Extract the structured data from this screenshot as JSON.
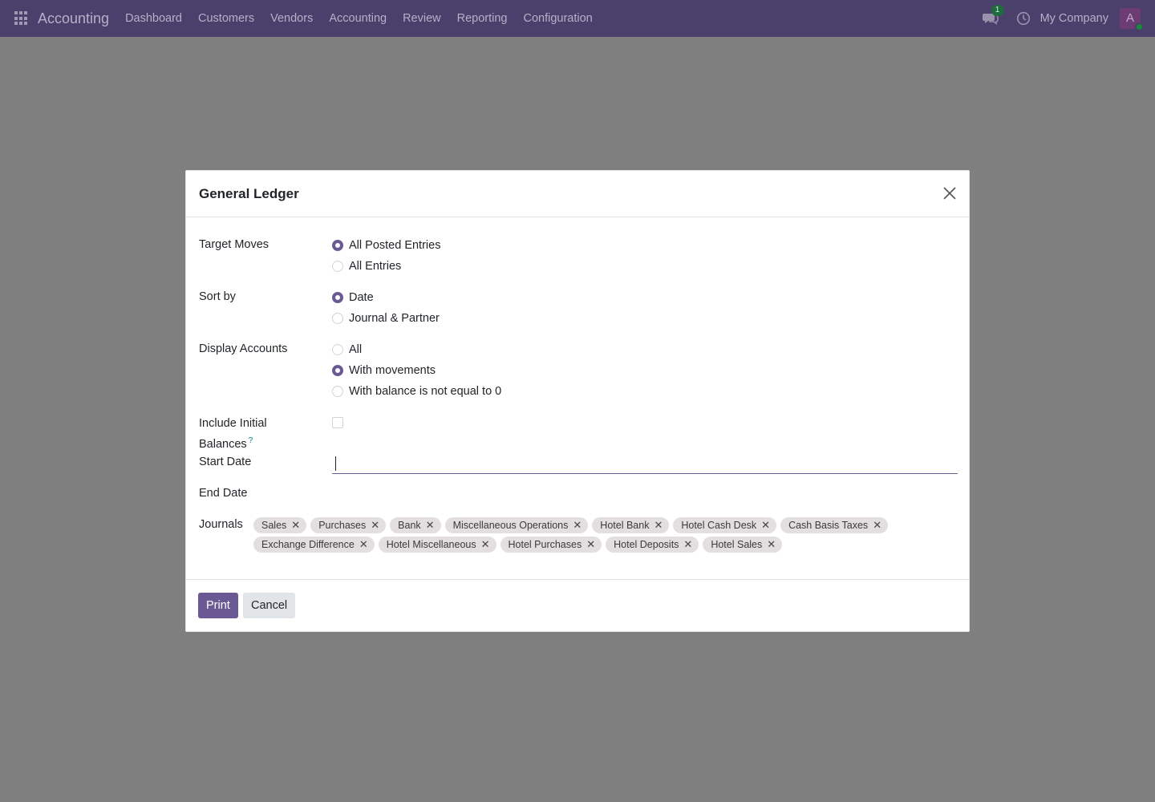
{
  "navbar": {
    "brand": "Accounting",
    "menu": [
      "Dashboard",
      "Customers",
      "Vendors",
      "Accounting",
      "Review",
      "Reporting",
      "Configuration"
    ],
    "chat_count": "1",
    "company": "My Company",
    "avatar_initial": "A"
  },
  "dialog": {
    "title": "General Ledger",
    "target_moves": {
      "label": "Target Moves",
      "options": [
        "All Posted Entries",
        "All Entries"
      ],
      "selected": 0
    },
    "sort_by": {
      "label": "Sort by",
      "options": [
        "Date",
        "Journal & Partner"
      ],
      "selected": 0
    },
    "display_accounts": {
      "label": "Display Accounts",
      "options": [
        "All",
        "With movements",
        "With balance is not equal to 0"
      ],
      "selected": 1
    },
    "initial_balances": {
      "label_line1": "Include Initial",
      "label_line2": "Balances",
      "help": "?",
      "checked": false
    },
    "start_date": {
      "label": "Start Date",
      "value": ""
    },
    "end_date": {
      "label": "End Date"
    },
    "journals": {
      "label": "Journals",
      "tags": [
        "Sales",
        "Purchases",
        "Bank",
        "Miscellaneous Operations",
        "Hotel Bank",
        "Hotel Cash Desk",
        "Cash Basis Taxes",
        "Exchange Difference",
        "Hotel Miscellaneous",
        "Hotel Purchases",
        "Hotel Deposits",
        "Hotel Sales"
      ]
    },
    "print_label": "Print",
    "cancel_label": "Cancel"
  }
}
